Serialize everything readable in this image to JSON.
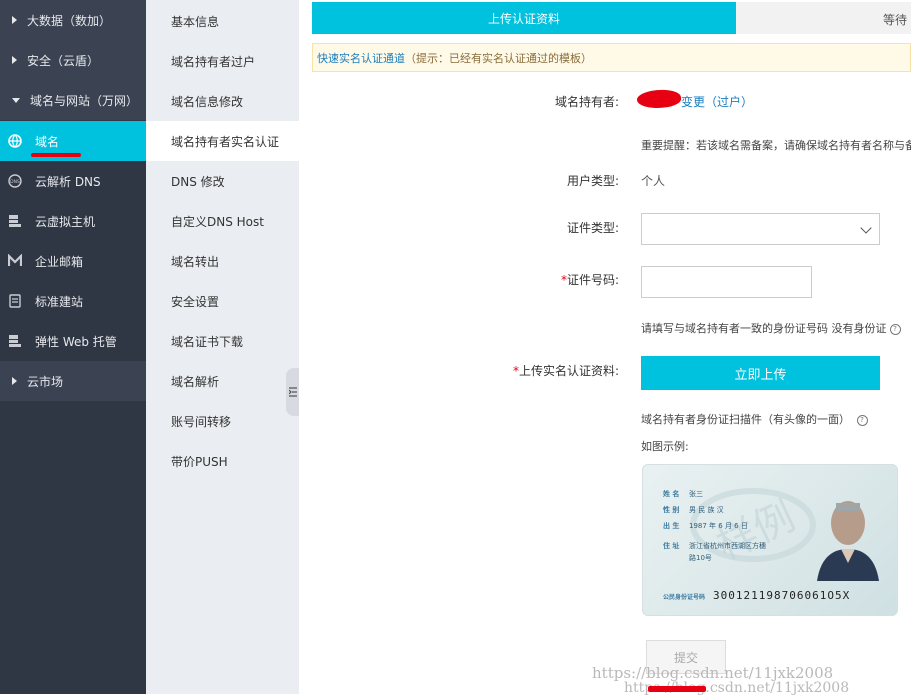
{
  "nav": {
    "items": [
      {
        "type": "category",
        "label": "大数据（数加）",
        "arrow": "right"
      },
      {
        "type": "category",
        "label": "安全（云盾）",
        "arrow": "right"
      },
      {
        "type": "category",
        "label": "域名与网站（万网）",
        "arrow": "down"
      },
      {
        "type": "item",
        "label": "域名",
        "icon": "globe-icon",
        "active": true
      },
      {
        "type": "item",
        "label": "云解析 DNS",
        "icon": "dns-icon"
      },
      {
        "type": "item",
        "label": "云虚拟主机",
        "icon": "server-icon"
      },
      {
        "type": "item",
        "label": "企业邮箱",
        "icon": "mail-m-icon"
      },
      {
        "type": "item",
        "label": "标准建站",
        "icon": "site-icon"
      },
      {
        "type": "item",
        "label": "弹性 Web 托管",
        "icon": "server-icon"
      },
      {
        "type": "category",
        "label": "云市场",
        "arrow": "right"
      }
    ]
  },
  "subnav": {
    "items": [
      "基本信息",
      "域名持有者过户",
      "域名信息修改",
      "域名持有者实名认证",
      "DNS 修改",
      "自定义DNS Host",
      "域名转出",
      "安全设置",
      "域名证书下载",
      "域名解析",
      "账号间转移",
      "带价PUSH"
    ],
    "active_index": 3
  },
  "steps": {
    "step1": "上传认证资料",
    "step2": "等待"
  },
  "tip": {
    "link": "快速实名认证通道",
    "hint": "（提示：已经有实名认证通过的模板）"
  },
  "form": {
    "holder_label": "域名持有者:",
    "change_link": "变更（过户）",
    "notice": "重要提醒：若该域名需备案，请确保域名持有者名称与备案",
    "user_type_label": "用户类型:",
    "user_type_value": "个人",
    "cert_type_label": "证件类型:",
    "cert_no_label": "证件号码:",
    "cert_no_hint": "请填写与域名持有者一致的身份证号码 没有身份证",
    "upload_label": "上传实名认证资料:",
    "upload_button": "立即上传",
    "upload_hint": "域名持有者身份证扫描件（有头像的一面）",
    "example_label": "如图示例:",
    "required_mark": "*",
    "submit_button": "提交"
  },
  "idcard": {
    "fields": [
      {
        "k": "姓 名",
        "v": "张三"
      },
      {
        "k": "性 别",
        "v": "男    民 族 汉"
      },
      {
        "k": "出 生",
        "v": "1987 年  6 月  6 日"
      },
      {
        "k": "住 址",
        "v": "浙江省杭州市西湖区方穗"
      },
      {
        "k": "",
        "v": "路10号"
      }
    ],
    "number_label": "公民身份证号码",
    "number": "300121198706061O5X"
  },
  "watermark": {
    "line1": "https://blog.csdn.net/11jxk2008",
    "line2": "https://blog.csdn.net/11jxk2008"
  }
}
